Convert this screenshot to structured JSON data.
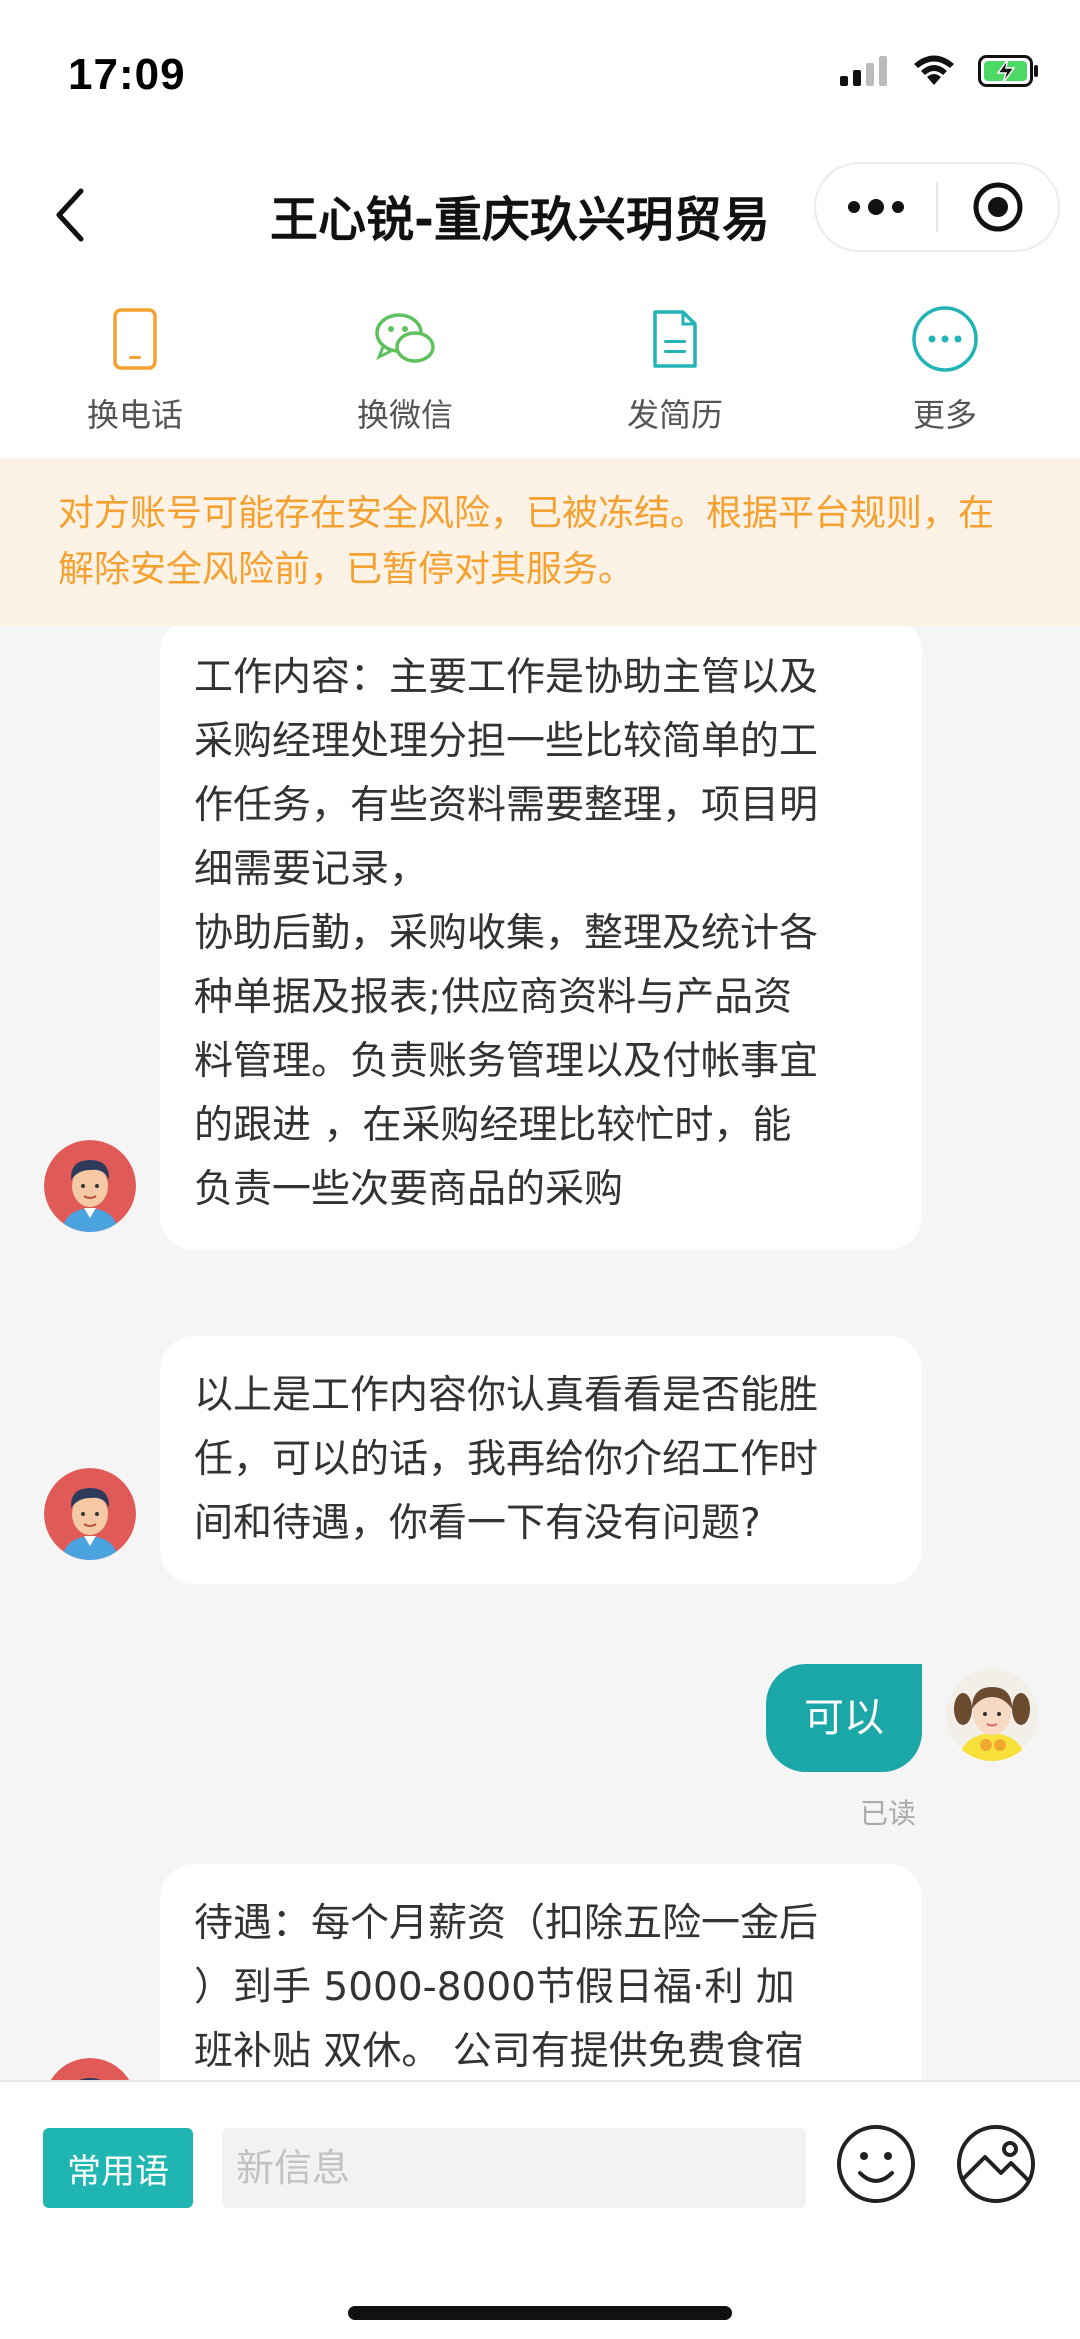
{
  "status_bar": {
    "time": "17:09"
  },
  "nav": {
    "title": "王心锐-重庆玖兴玥贸易"
  },
  "actions": [
    {
      "label": "换电话",
      "icon": "phone-icon",
      "color": "#f5a131"
    },
    {
      "label": "换微信",
      "icon": "wechat-icon",
      "color": "#5ec15e"
    },
    {
      "label": "发简历",
      "icon": "resume-icon",
      "color": "#21b3b5"
    },
    {
      "label": "更多",
      "icon": "more-icon",
      "color": "#21b3b5"
    }
  ],
  "warning": {
    "text": "对方账号可能存在安全风险，已被冻结。根据平台规则，在解除安全风险前，已暂停对其服务。"
  },
  "messages": [
    {
      "side": "left",
      "lines": [
        "工作内容：主要工作是协助主管以及",
        "采购经理处理分担一些比较简单的工",
        "作任务，有些资料需要整理，项目明",
        "细需要记录，",
        "协助后勤，采购收集，整理及统计各",
        "种单据及报表;供应商资料与产品资",
        "料管理。负责账务管理以及付帐事宜",
        "的跟进 ，在采购经理比较忙时，能",
        "负责一些次要商品的采购"
      ]
    },
    {
      "side": "left",
      "lines": [
        "以上是工作内容你认真看看是否能胜",
        "任，可以的话，我再给你介绍工作时",
        "间和待遇，你看一下有没有问题?"
      ]
    },
    {
      "side": "right",
      "text": "可以",
      "status": "已读"
    },
    {
      "side": "left",
      "lines": [
        "待遇：每个月薪资（扣除五险一金后",
        "）到手 5000-8000节假日福·利 加",
        "班补贴 双休。  公司有提供免费食宿"
      ]
    }
  ],
  "input_bar": {
    "phrase_button": "常用语",
    "placeholder": "新信息"
  },
  "colors": {
    "accent": "#1ba6a8",
    "warning_text": "#f5a131",
    "warning_bg": "#fdf2e6"
  }
}
